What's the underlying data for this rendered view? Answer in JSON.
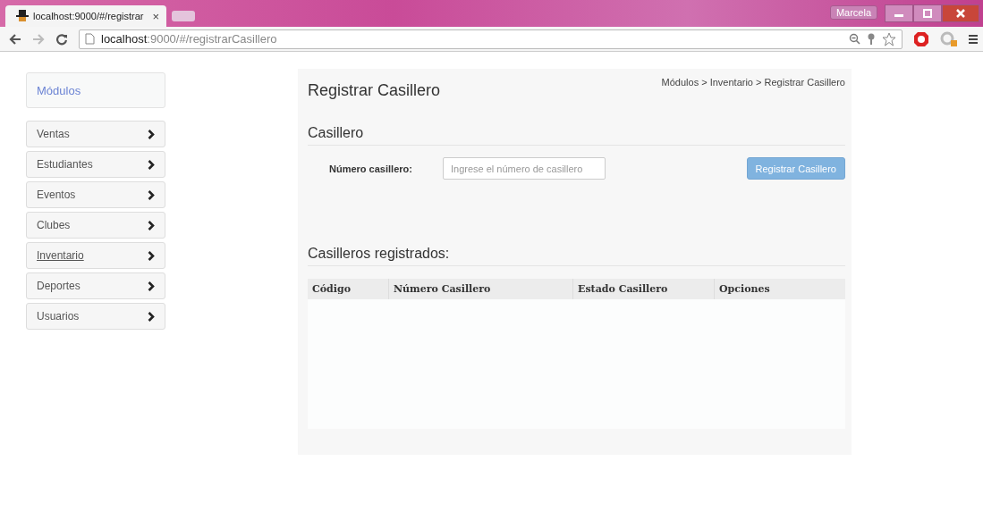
{
  "browser": {
    "tab_title": "localhost:9000/#/registrar",
    "tab_close": "×",
    "profile": "Marcela",
    "url_host": "localhost",
    "url_rest": ":9000/#/registrarCasillero"
  },
  "sidebar": {
    "title": "Módulos",
    "items": [
      {
        "label": "Ventas",
        "selected": false
      },
      {
        "label": "Estudiantes",
        "selected": false
      },
      {
        "label": "Eventos",
        "selected": false
      },
      {
        "label": "Clubes",
        "selected": false
      },
      {
        "label": "Inventario",
        "selected": true
      },
      {
        "label": "Deportes",
        "selected": false
      },
      {
        "label": "Usuarios",
        "selected": false
      }
    ]
  },
  "page": {
    "title": "Registrar Casillero",
    "breadcrumb": "Módulos > Inventario > Registrar Casillero",
    "section": "Casillero",
    "field_label": "Número casillero:",
    "field_placeholder": "Ingrese el número de casillero",
    "submit": "Registrar Casillero",
    "table_title": "Casilleros registrados:",
    "table": {
      "columns": [
        "Código",
        "Número Casillero",
        "Estado Casillero",
        "Opciones"
      ]
    }
  }
}
